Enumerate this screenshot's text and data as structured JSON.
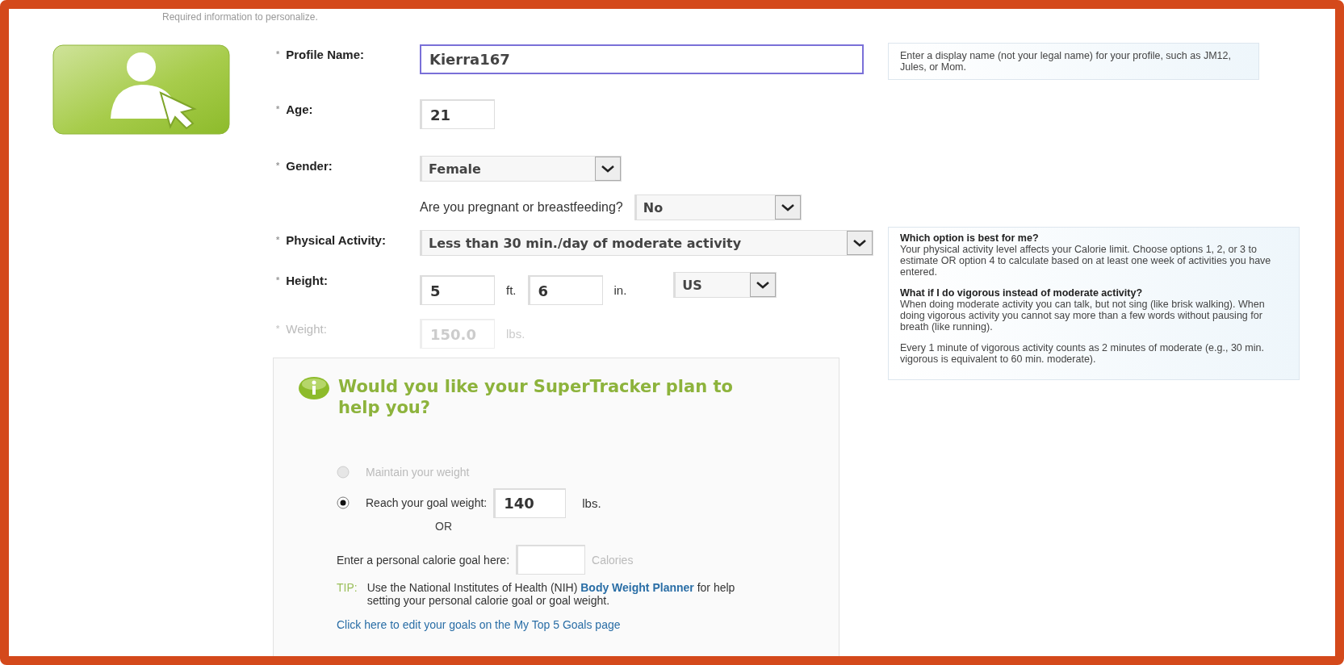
{
  "note": "Required information to personalize.",
  "fields": [
    {
      "kind": "text",
      "required_mark": "*",
      "label": "Profile Name:",
      "value": "Kierra167",
      "focused": true,
      "disabled": false
    },
    {
      "kind": "text",
      "required_mark": "*",
      "label": "Age:",
      "value": "21",
      "focused": false,
      "disabled": false
    },
    {
      "kind": "select",
      "required_mark": "*",
      "label": "Gender:",
      "value": "Female",
      "focused": false,
      "disabled": false
    },
    {
      "kind": "question",
      "question": "Are you pregnant or breastfeeding?",
      "value": "No",
      "focused": false,
      "disabled": false
    },
    {
      "kind": "select",
      "required_mark": "*",
      "label": "Physical Activity:",
      "value": "Less than 30 min./day of moderate activity",
      "focused": false,
      "disabled": false
    },
    {
      "kind": "height",
      "required_mark": "*",
      "label": "Height:",
      "feet": "5",
      "feet_unit": "ft.",
      "inches": "6",
      "inches_unit": "in.",
      "system": "US",
      "focused": false,
      "disabled": false
    },
    {
      "kind": "weight",
      "required_mark": "*",
      "label": "Weight:",
      "value": "150.0",
      "unit": "lbs.",
      "focused": false,
      "disabled": true
    }
  ],
  "profile_tip": "Enter a display name (not your legal name) for your profile, such as JM12, Jules, or Mom.",
  "activity_tip": [
    {
      "heading": "Which option is best for me?",
      "body": "Your physical activity level affects your Calorie limit. Choose options 1, 2, or 3 to estimate OR option 4 to calculate based on at least one week of activities you have entered."
    },
    {
      "heading": "What if I do vigorous instead of moderate activity?",
      "body": "When doing moderate activity you can talk, but not sing (like brisk walking). When doing vigorous activity you cannot say more than a few words without pausing for breath (like running)."
    },
    {
      "body": "Every 1 minute of vigorous activity counts as 2 minutes of moderate (e.g., 30 min. vigorous is equivalent to 60 min. moderate)."
    }
  ],
  "plan": {
    "title": "Would you like your SuperTracker plan to help you?",
    "options": [
      {
        "label": "Maintain your weight",
        "selected": false,
        "disabled": true
      },
      {
        "label": "Reach your goal weight:",
        "selected": true,
        "disabled": false,
        "value": "140",
        "unit": "lbs."
      }
    ],
    "or": "OR",
    "calorie": {
      "label": "Enter a personal calorie goal here:",
      "unit": "Calories"
    },
    "tip": {
      "label": "TIP:",
      "before": "Use the National Institutes of Health (NIH)",
      "link": "Body Weight Planner",
      "after": "for help setting your personal calorie goal or goal weight."
    },
    "edit_link": "Click here to edit your goals on the My Top 5 Goals page"
  }
}
